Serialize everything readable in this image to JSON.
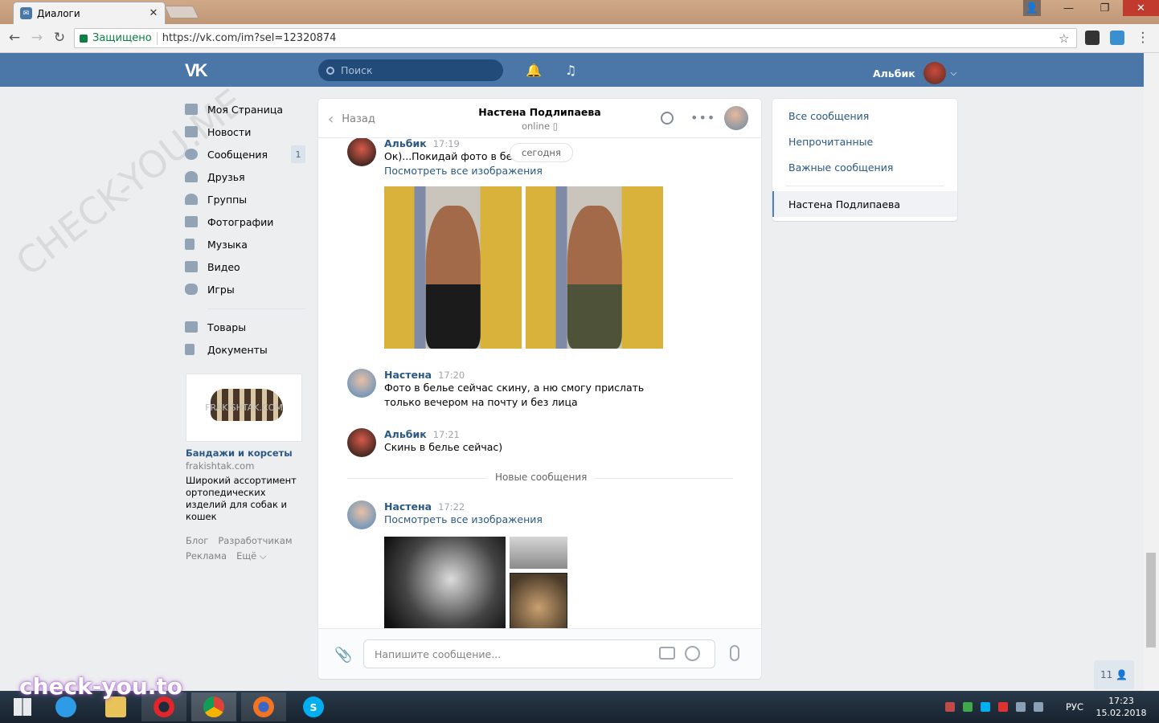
{
  "browser": {
    "tab_title": "Диалоги",
    "secure_label": "Защищено",
    "url": "https://vk.com/im?sel=12320874"
  },
  "header": {
    "search_placeholder": "Поиск",
    "user_name": "Альбик"
  },
  "menu": {
    "items": [
      {
        "label": "Моя Страница",
        "icon": "home-icon"
      },
      {
        "label": "Новости",
        "icon": "news-icon"
      },
      {
        "label": "Сообщения",
        "icon": "messages-icon",
        "badge": "1"
      },
      {
        "label": "Друзья",
        "icon": "friends-icon"
      },
      {
        "label": "Группы",
        "icon": "groups-icon"
      },
      {
        "label": "Фотографии",
        "icon": "camera-icon"
      },
      {
        "label": "Музыка",
        "icon": "music-icon"
      },
      {
        "label": "Видео",
        "icon": "video-icon"
      },
      {
        "label": "Игры",
        "icon": "games-icon"
      }
    ],
    "secondary": [
      {
        "label": "Товары",
        "icon": "bag-icon"
      },
      {
        "label": "Документы",
        "icon": "document-icon"
      }
    ]
  },
  "ad": {
    "image_text": "FRAKISHTAK.COM",
    "title": "Бандажи и корсеты",
    "domain": "frakishtak.com",
    "description": "Широкий ассортимент ортопедических изделий для собак и кошек"
  },
  "footer": {
    "links": [
      "Блог",
      "Разработчикам",
      "Реклама",
      "Ещё ⌵"
    ]
  },
  "chat": {
    "back_label": "Назад",
    "peer_name": "Настена Подлипаева",
    "peer_status": "online ▯",
    "date_pill": "сегодня",
    "new_messages_label": "Новые сообщения",
    "composer_placeholder": "Напишите сообщение...",
    "messages": [
      {
        "author": "Альбик",
        "time": "17:19",
        "text": "Ок)...Покидай фото в белье",
        "link": "Посмотреть все изображения"
      },
      {
        "author": "Настена",
        "time": "17:20",
        "text": "Фото в белье сейчас скину, а ню смогу прислать только вечером на почту и без лица"
      },
      {
        "author": "Альбик",
        "time": "17:21",
        "text": "Скинь в белье сейчас)"
      },
      {
        "author": "Настена",
        "time": "17:22",
        "link": "Посмотреть все изображения"
      }
    ]
  },
  "right_panel": {
    "all": "Все сообщения",
    "unread": "Непрочитанные",
    "important": "Важные сообщения",
    "active": "Настена Подлипаева"
  },
  "online_counter": "11 👤",
  "taskbar": {
    "lang": "РУС",
    "time": "17:23",
    "date": "15.02.2018"
  },
  "watermark": {
    "bottom": "check-you.to",
    "diagonal": "CHECK-YOU.ME"
  },
  "colors": {
    "vk_blue": "#4a76a8",
    "link": "#2a5885",
    "background": "#edeef0"
  }
}
